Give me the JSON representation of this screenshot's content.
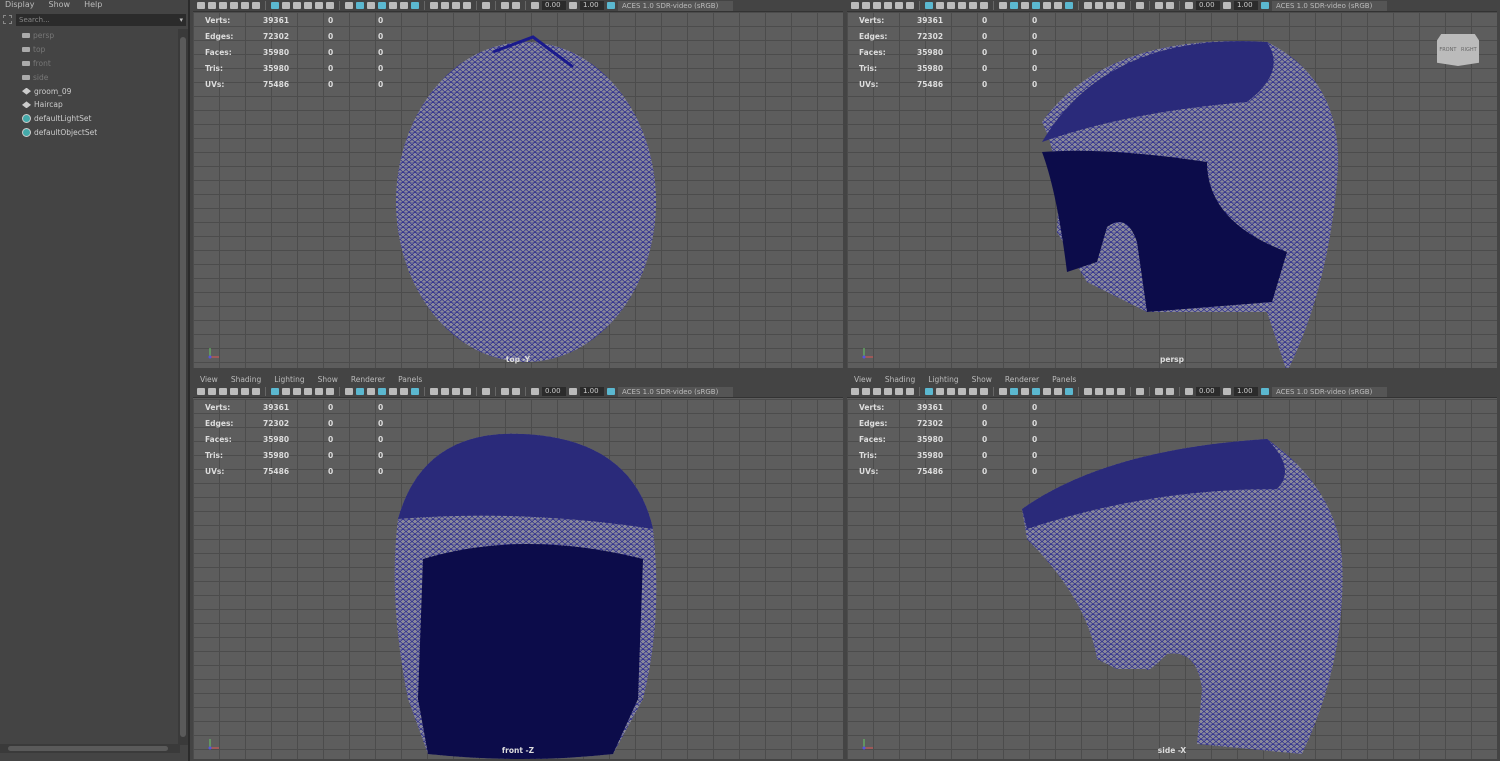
{
  "outliner": {
    "menu": [
      "Display",
      "Show",
      "Help"
    ],
    "search_placeholder": "Search...",
    "items": [
      {
        "label": "persp",
        "type": "camera",
        "dim": true
      },
      {
        "label": "top",
        "type": "camera",
        "dim": true
      },
      {
        "label": "front",
        "type": "camera",
        "dim": true
      },
      {
        "label": "side",
        "type": "camera",
        "dim": true
      },
      {
        "label": "groom_09",
        "type": "group"
      },
      {
        "label": "Haircap",
        "type": "group"
      },
      {
        "label": "defaultLightSet",
        "type": "set"
      },
      {
        "label": "defaultObjectSet",
        "type": "set"
      }
    ]
  },
  "panel_menu": [
    "View",
    "Shading",
    "Lighting",
    "Show",
    "Renderer",
    "Panels"
  ],
  "toolbar": {
    "exposure": "0.00",
    "gamma": "1.00",
    "color_space": "ACES 1.0 SDR-video (sRGB)"
  },
  "hud": {
    "rows": [
      [
        "Verts:",
        "39361",
        "0",
        "0"
      ],
      [
        "Edges:",
        "72302",
        "0",
        "0"
      ],
      [
        "Faces:",
        "35980",
        "0",
        "0"
      ],
      [
        "Tris:",
        "35980",
        "0",
        "0"
      ],
      [
        "UVs:",
        "75486",
        "0",
        "0"
      ]
    ]
  },
  "viewports": [
    {
      "camera": "top -Y"
    },
    {
      "camera": "persp"
    },
    {
      "camera": "front -Z"
    },
    {
      "camera": "side -X"
    }
  ],
  "view_cube": {
    "front": "FRONT",
    "right": "RIGHT"
  },
  "colors": {
    "mesh_wire": "#1a1a8c",
    "mesh_fill": "#8a8a9a",
    "accent": "#5bb8d0"
  }
}
